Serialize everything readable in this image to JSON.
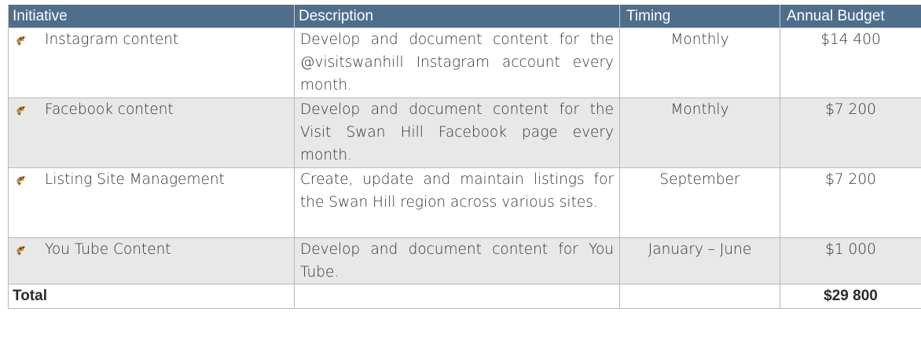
{
  "table": {
    "headers": {
      "initiative": "Initiative",
      "description": "Description",
      "timing": "Timing",
      "budget": "Annual Budget"
    },
    "bullet_icon": "bird-bullet-icon",
    "colors": {
      "header_bg": "#4f6e8c",
      "header_text": "#ffffff",
      "alt_row_bg": "#e8e8e8"
    },
    "rows": [
      {
        "initiative": "Instagram content",
        "description": "Develop and document content for the @visitswanhill Instagram account every month.",
        "timing": "Monthly",
        "budget": "$14 400"
      },
      {
        "initiative": "Facebook content",
        "description": "Develop and document content for the Visit Swan Hill Facebook page every month.",
        "timing": "Monthly",
        "budget": "$7 200"
      },
      {
        "initiative": "Listing Site Management",
        "description": "Create, update and maintain listings for the Swan Hill region across various sites.",
        "timing": "September",
        "budget": "$7 200"
      },
      {
        "initiative": "You Tube Content",
        "description": "Develop and document content for You Tube.",
        "timing": "January – June",
        "budget": "$1 000"
      }
    ],
    "total": {
      "label": "Total",
      "budget": "$29 800"
    }
  }
}
